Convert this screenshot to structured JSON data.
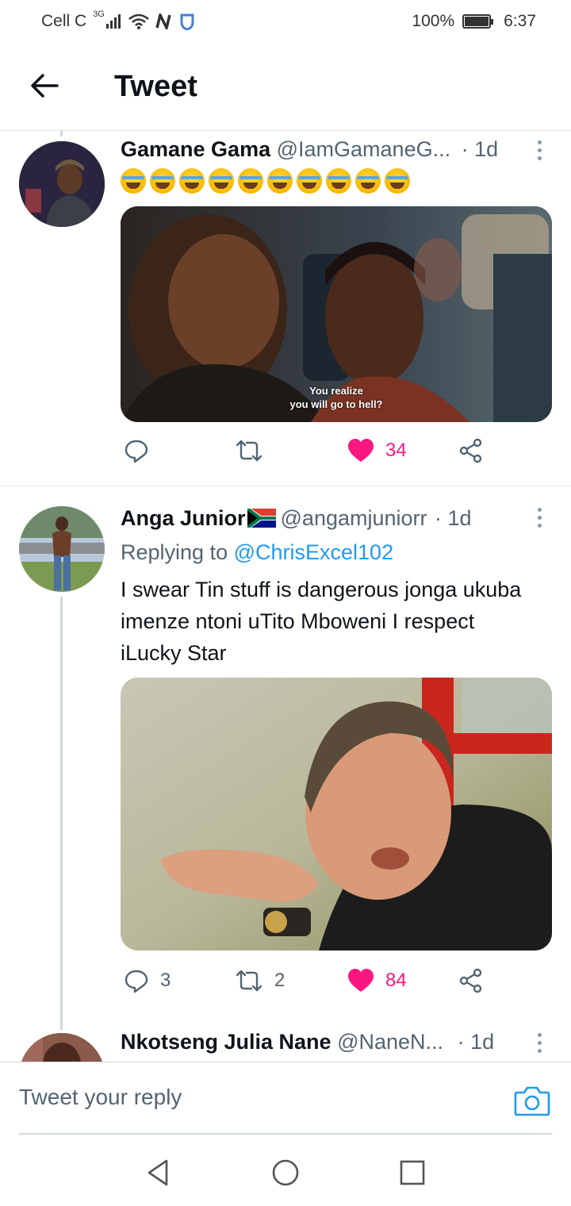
{
  "status_bar": {
    "carrier": "Cell C",
    "network": "3G",
    "battery": "100%",
    "time": "6:37"
  },
  "header": {
    "title": "Tweet"
  },
  "tweets": [
    {
      "name": "Gamane Gama",
      "handle": "@IamGamaneG...",
      "time": "· 1d",
      "emoji_text": "🤣🤣🤣🤣🤣🤣🤣🤣🤣🤣",
      "media_caption_line1": "You realize",
      "media_caption_line2": "you will go to hell?",
      "replies": "",
      "retweets": "",
      "likes": "34"
    },
    {
      "name": "Anga Junior",
      "flag": "🇿🇦",
      "handle": "@angamjuniorr",
      "time": "· 1d",
      "replying_prefix": "Replying to",
      "replying_to": "@ChrisExcel102",
      "text": "I swear Tin stuff is dangerous jonga ukuba imenze ntoni uTito Mboweni I respect iLucky Star",
      "replies": "3",
      "retweets": "2",
      "likes": "84"
    },
    {
      "name": "Nkotseng Julia Nane",
      "handle": "@NaneN...",
      "time": "· 1d"
    }
  ],
  "reply_box": {
    "placeholder": "Tweet your reply"
  },
  "colors": {
    "like": "#f91880",
    "link": "#1d9bf0",
    "muted": "#536471"
  }
}
